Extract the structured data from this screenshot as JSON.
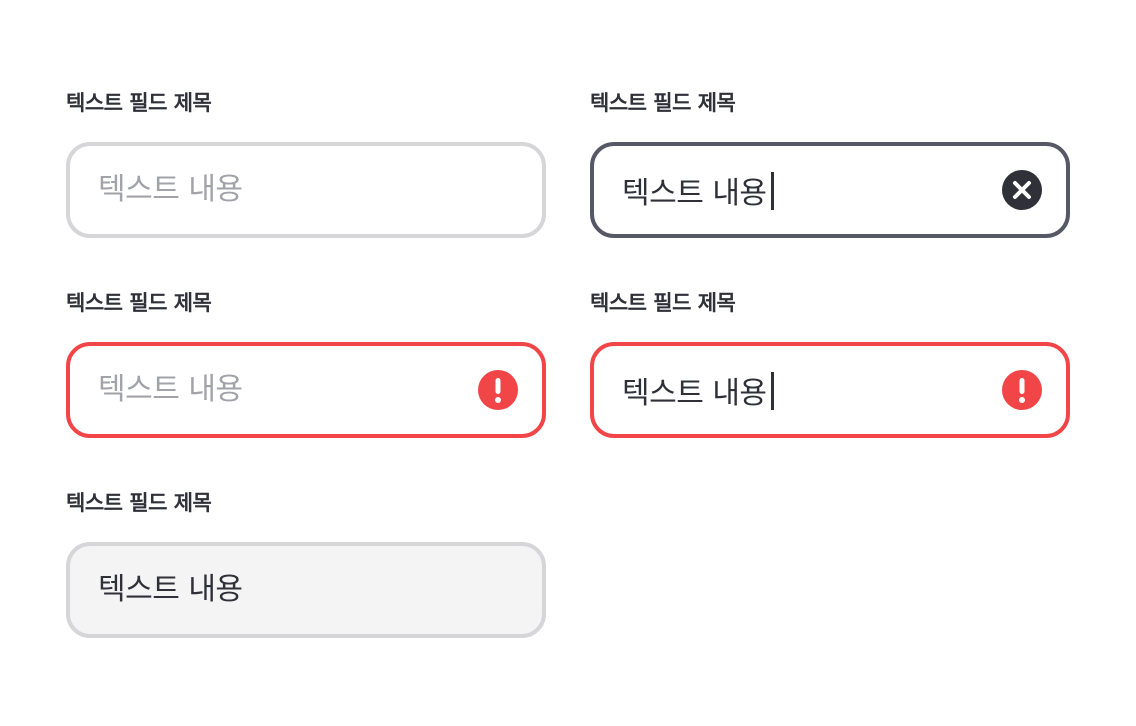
{
  "fields": [
    {
      "label": "텍스트 필드 제목",
      "value": "",
      "placeholder": "텍스트 내용",
      "state": "default"
    },
    {
      "label": "텍스트 필드 제목",
      "value": "텍스트 내용",
      "placeholder": "",
      "state": "focused",
      "trailing_icon": "clear-icon"
    },
    {
      "label": "텍스트 필드 제목",
      "value": "",
      "placeholder": "텍스트 내용",
      "state": "error",
      "trailing_icon": "error-icon"
    },
    {
      "label": "텍스트 필드 제목",
      "value": "텍스트 내용",
      "placeholder": "",
      "state": "error-focused",
      "trailing_icon": "error-icon"
    },
    {
      "label": "텍스트 필드 제목",
      "value": "텍스트 내용",
      "placeholder": "",
      "state": "filled-disabled"
    }
  ],
  "colors": {
    "text": "#2f3038",
    "placeholder": "#a2a3a8",
    "border_default": "#d6d6d8",
    "border_focused": "#575866",
    "error": "#f14548",
    "disabled_bg": "#f4f4f5"
  }
}
